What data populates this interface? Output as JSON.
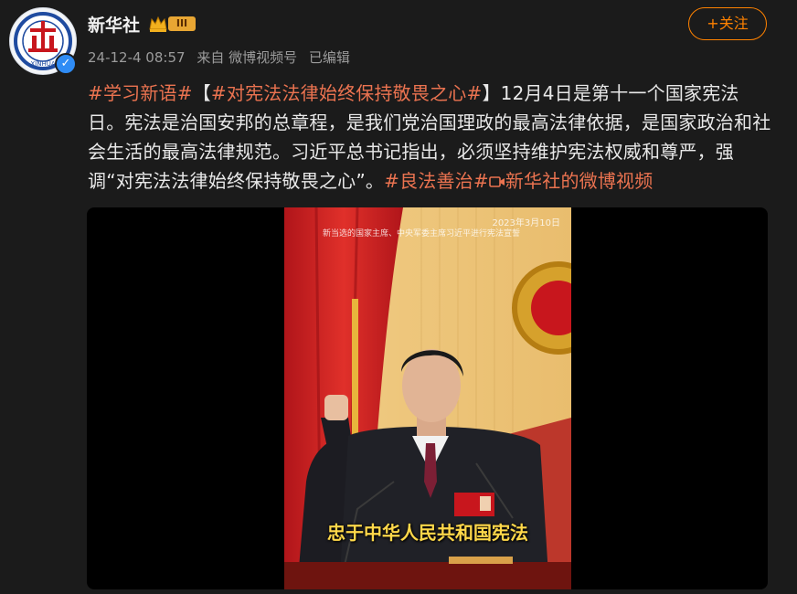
{
  "author": {
    "name": "新华社",
    "level": "III",
    "avatar_text": "XINHUA"
  },
  "meta": {
    "date": "24-12-4 08:57",
    "source": "来自 微博视频号",
    "edited": "已编辑"
  },
  "follow_label": "+关注",
  "post": {
    "tag1": "#学习新语#",
    "bracket_open": "【",
    "tag2": "#对宪法法律始终保持敬畏之心#",
    "bracket_close": "】",
    "body": "12月4日是第十一个国家宪法日。宪法是治国安邦的总章程，是我们党治国理政的最高法律依据，是国家政治和社会生活的最高法律规范。习近平总书记指出，必须坚持维护宪法权威和尊严，强调“对宪法法律始终保持敬畏之心”。",
    "tag3": "#良法善治#",
    "video_link_icon": "video-link-icon",
    "video_link": "新华社的微博视频"
  },
  "video": {
    "date_overlay": "2023年3月10日",
    "caption_top": "新当选的国家主席、中央军委主席习近平进行宪法宣誓",
    "subtitle": "忠于中华人民共和国宪法"
  },
  "colors": {
    "accent": "#ff8200",
    "tag": "#eb7350",
    "background": "#1b1b1b",
    "verified": "#2f8cf5"
  }
}
